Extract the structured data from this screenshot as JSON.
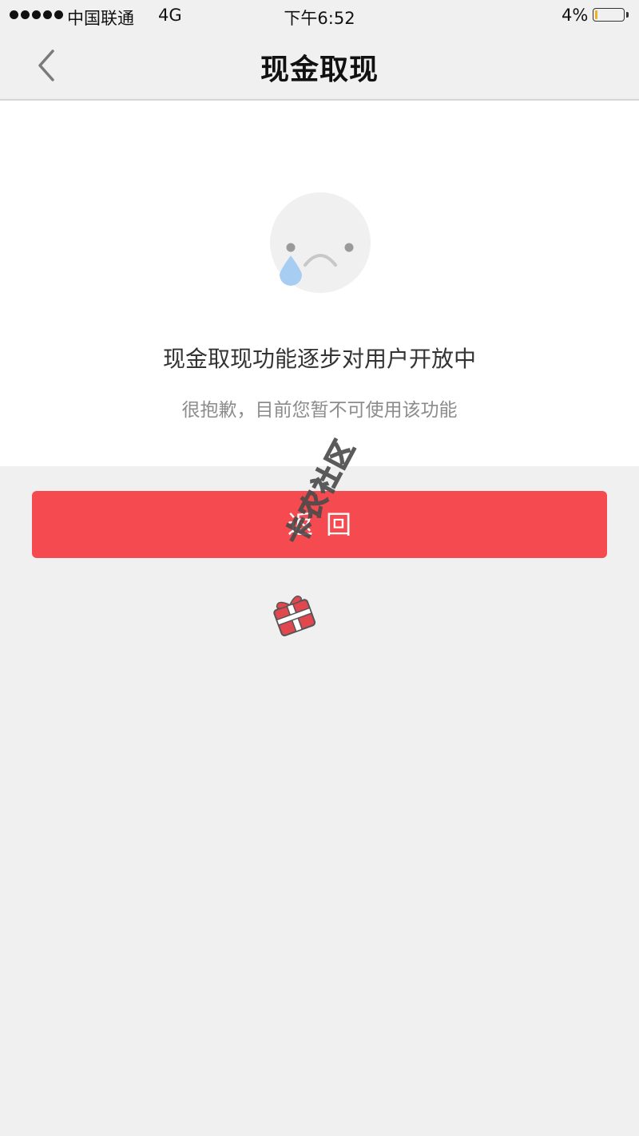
{
  "status_bar": {
    "carrier": "中国联通",
    "network": "4G",
    "time": "下午6:52",
    "battery_percent": "4%"
  },
  "nav": {
    "title": "现金取现",
    "back_icon": "chevron-left-icon"
  },
  "message": {
    "icon": "crying-face-icon",
    "title": "现金取现功能逐步对用户开放中",
    "subtitle": "很抱歉，目前您暂不可使用该功能"
  },
  "actions": {
    "return_label": "返回"
  },
  "watermark": {
    "text": "卡农社区"
  },
  "colors": {
    "accent": "#f44a50",
    "background": "#f0f0f1",
    "panel": "#ffffff",
    "title_text": "#333333",
    "sub_text": "#8c8c8c"
  }
}
